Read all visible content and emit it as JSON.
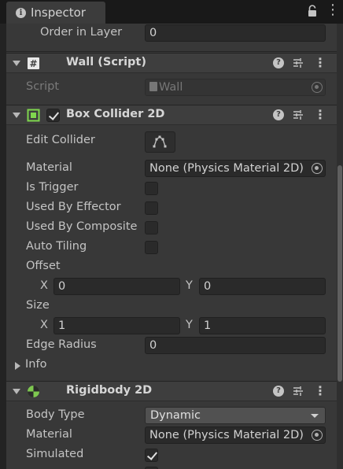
{
  "window": {
    "tab_title": "Inspector"
  },
  "order_in_layer": {
    "label": "Order in Layer",
    "value": "0"
  },
  "wall_script": {
    "title": "Wall (Script)",
    "script_label": "Script",
    "script_value": "Wall"
  },
  "box_collider": {
    "title": "Box Collider 2D",
    "edit_collider_label": "Edit Collider",
    "material_label": "Material",
    "material_value": "None (Physics Material 2D)",
    "is_trigger_label": "Is Trigger",
    "is_trigger": false,
    "used_by_effector_label": "Used By Effector",
    "used_by_effector": false,
    "used_by_composite_label": "Used By Composite",
    "used_by_composite": false,
    "auto_tiling_label": "Auto Tiling",
    "auto_tiling": false,
    "offset_label": "Offset",
    "offset_x": "0",
    "offset_y": "0",
    "size_label": "Size",
    "size_x": "1",
    "size_y": "1",
    "x_label": "X",
    "y_label": "Y",
    "edge_radius_label": "Edge Radius",
    "edge_radius_value": "0",
    "info_label": "Info"
  },
  "rigidbody": {
    "title": "Rigidbody 2D",
    "body_type_label": "Body Type",
    "body_type_value": "Dynamic",
    "material_label": "Material",
    "material_value": "None (Physics Material 2D)",
    "simulated_label": "Simulated",
    "simulated": true
  },
  "icons": {
    "tab": "info-icon",
    "lock": "lock-icon",
    "menu": "kebab-menu-icon",
    "script": "script-hash-icon",
    "collider": "box-collider-icon",
    "rigidbody": "rigidbody-icon",
    "help": "help-icon",
    "preset": "preset-icon",
    "object_picker": "object-picker-icon",
    "edit_collider": "edit-collider-icon"
  },
  "colors": {
    "panel_bg": "#383838",
    "header_bg": "#3e3e3e",
    "field_bg": "#2a2a2a",
    "collider_icon": "#7fd64e",
    "rigidbody_icon": "#7ec850"
  }
}
